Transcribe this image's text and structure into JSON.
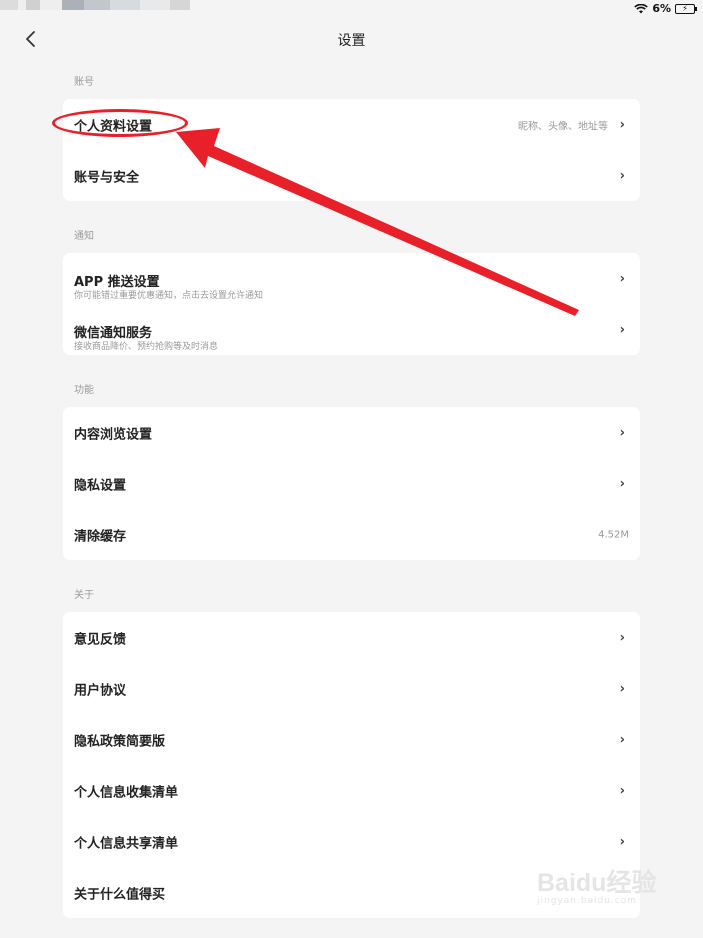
{
  "status": {
    "battery": "6%"
  },
  "header": {
    "title": "设置"
  },
  "sections": {
    "account": {
      "label": "账号",
      "items": [
        {
          "label": "个人资料设置",
          "hint": "昵称、头像、地址等"
        },
        {
          "label": "账号与安全"
        }
      ]
    },
    "notify": {
      "label": "通知",
      "items": [
        {
          "label": "APP 推送设置",
          "sub": "你可能错过重要优惠通知，点击去设置允许通知"
        },
        {
          "label": "微信通知服务",
          "sub": "接收商品降价、预约抢购等及时消息"
        }
      ]
    },
    "features": {
      "label": "功能",
      "items": [
        {
          "label": "内容浏览设置"
        },
        {
          "label": "隐私设置"
        },
        {
          "label": "清除缓存",
          "value": "4.52M"
        }
      ]
    },
    "about": {
      "label": "关于",
      "items": [
        {
          "label": "意见反馈"
        },
        {
          "label": "用户协议"
        },
        {
          "label": "隐私政策简要版"
        },
        {
          "label": "个人信息收集清单"
        },
        {
          "label": "个人信息共享清单"
        },
        {
          "label": "关于什么值得买"
        }
      ]
    }
  },
  "watermark": {
    "brand": "Baidu经验",
    "url": "jingyan.baidu.com"
  },
  "colors": {
    "annotation": "#e8202a",
    "background": "#f4f4f4",
    "card": "#ffffff"
  }
}
